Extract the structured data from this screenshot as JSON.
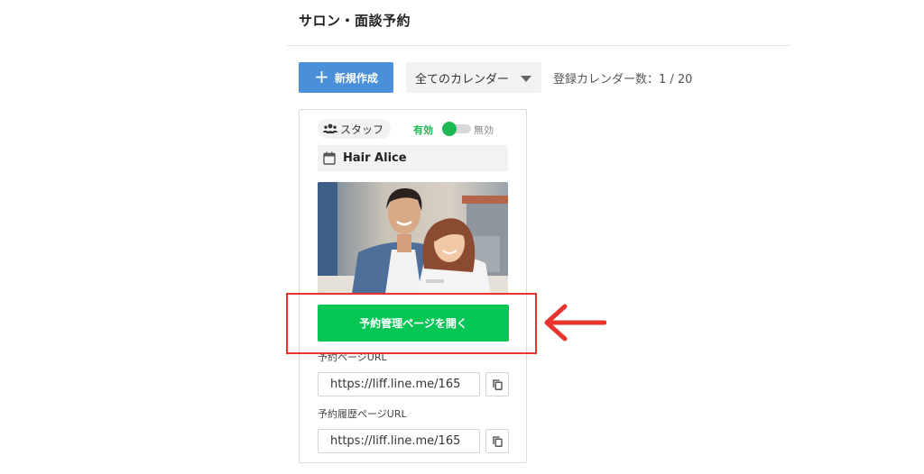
{
  "header": {
    "title": "サロン・面談予約"
  },
  "toolbar": {
    "new_button_label": "新規作成",
    "new_icon": "plus-icon",
    "calendar_filter": {
      "selected": "全てのカレンダー"
    },
    "registered_count": "登録カレンダー数：1 / 20"
  },
  "card": {
    "type_badge": "スタッフ",
    "type_icon": "people-icon",
    "toggle": {
      "on_label": "有効",
      "off_label": "無効",
      "state": "on"
    },
    "calendar_icon": "calendar-icon",
    "calendar_name": "Hair Alice",
    "open_button_label": "予約管理ページを開く",
    "booking_url": {
      "label": "予約ページURL",
      "value": "https://liff.line.me/165"
    },
    "history_url": {
      "label": "予約履歴ページURL",
      "value": "https://liff.line.me/165"
    }
  },
  "colors": {
    "primary_blue": "#4a90d9",
    "line_green": "#06c755",
    "toggle_green": "#1db954",
    "annotation_red": "#e8342e"
  }
}
